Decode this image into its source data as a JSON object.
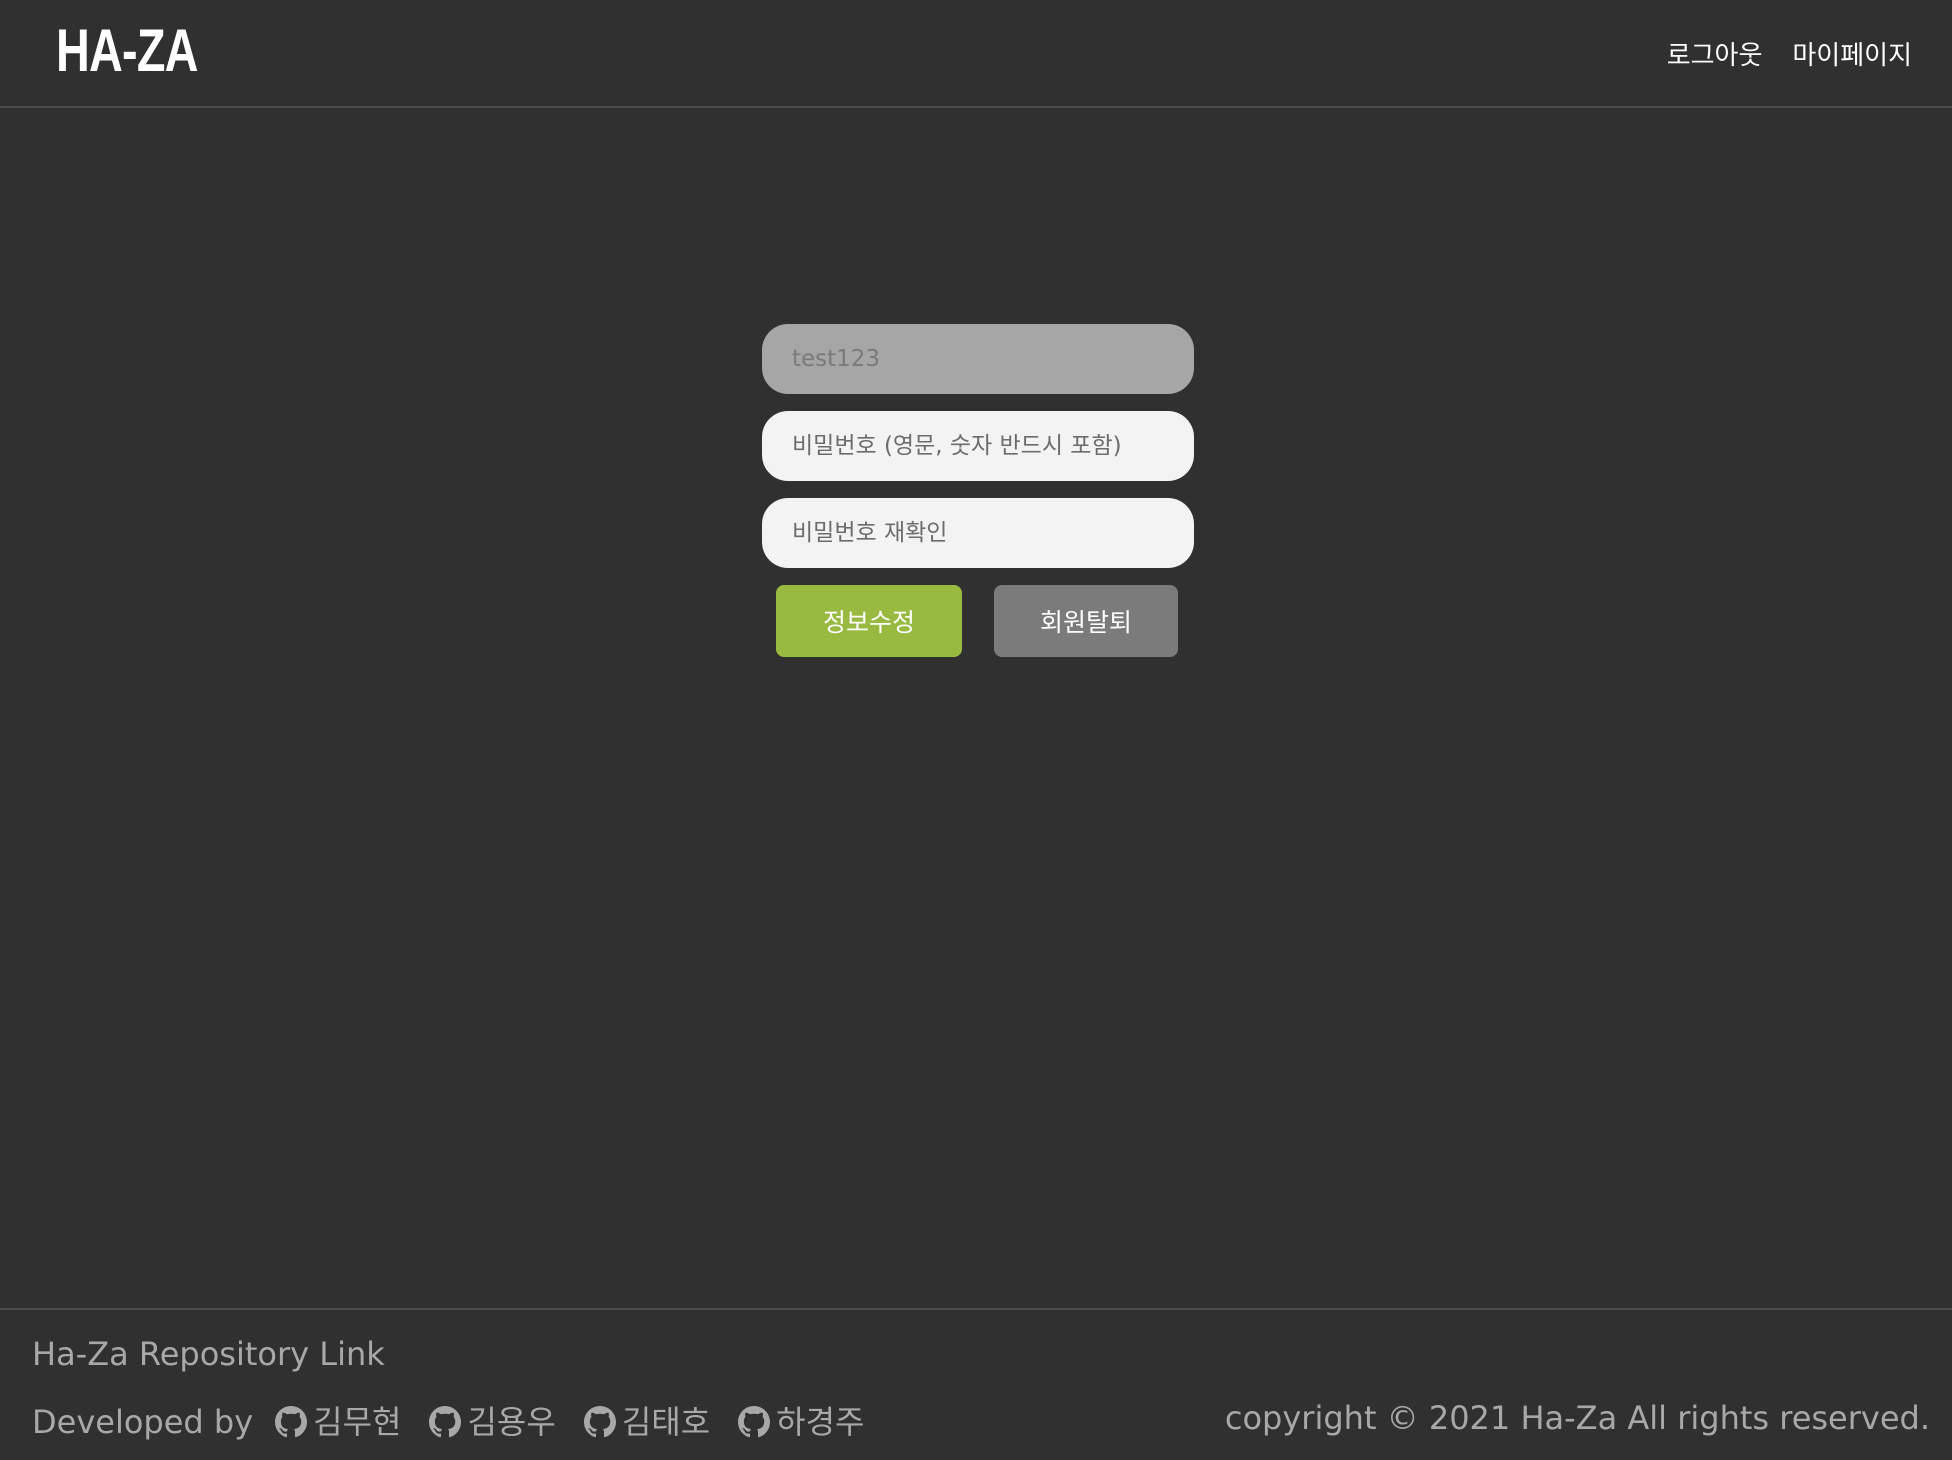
{
  "header": {
    "logo": "HA-ZA",
    "nav": {
      "logout": "로그아웃",
      "mypage": "마이페이지"
    }
  },
  "form": {
    "user_id": "test123",
    "password_placeholder": "비밀번호 (영문, 숫자 반드시 포함)",
    "password_confirm_placeholder": "비밀번호 재확인",
    "edit_button": "정보수정",
    "withdraw_button": "회원탈퇴"
  },
  "footer": {
    "repo_link": "Ha-Za Repository Link",
    "developed_by": "Developed by",
    "developers": [
      "김무현",
      "김용우",
      "김태호",
      "하경주"
    ],
    "copyright": "copyright © 2021 Ha-Za All rights reserved."
  },
  "icons": {
    "developer_link": "github-icon"
  },
  "colors": {
    "background": "#303030",
    "edit_button": "#98ba41",
    "withdraw_button": "#7b7b7b",
    "id_field": "#a6a6a6",
    "password_field": "#f3f3f3",
    "footer_text": "#a8a8a8"
  }
}
